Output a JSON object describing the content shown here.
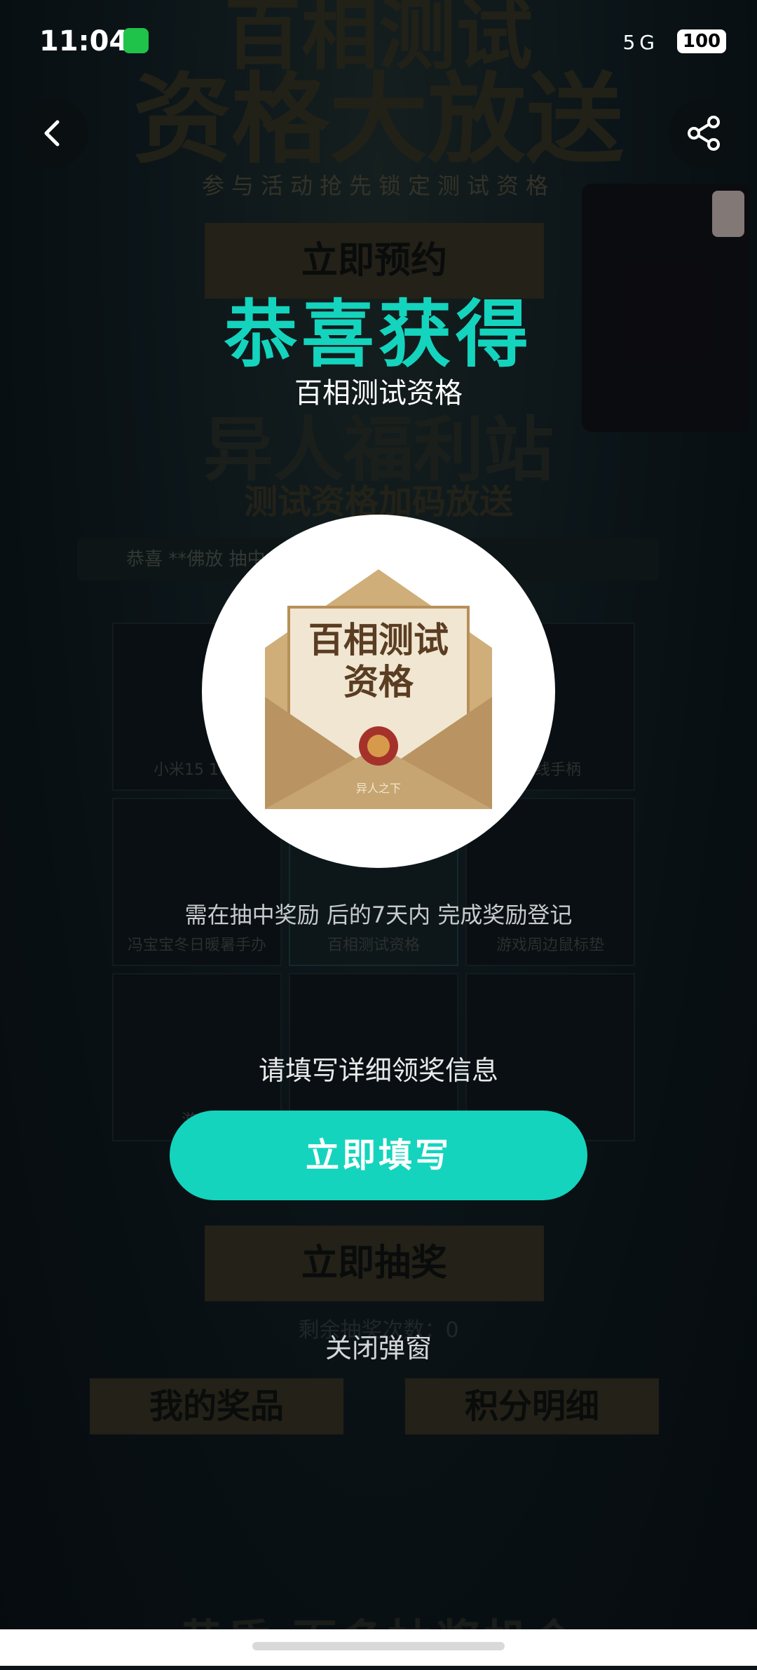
{
  "status_bar": {
    "time": "11:04",
    "signal": "5G",
    "battery": "100"
  },
  "nav": {
    "back_icon": "chevron-left-icon",
    "share_icon": "share-icon"
  },
  "background": {
    "title_line1": "百相测试",
    "title_line2": "资格大放送",
    "subtitle": "参与活动抢先锁定测试资格",
    "reserve_button": "立即预约",
    "welfare_title": "异人福利站",
    "welfare_subtitle": "测试资格加码放送",
    "ticker": "恭喜 **佛放 抽中",
    "grid": [
      {
        "label": "小米15 16G"
      },
      {
        "label": ""
      },
      {
        "label": "无线手柄"
      },
      {
        "label": "冯宝宝冬日暖暑手办"
      },
      {
        "label": "百相测试资格"
      },
      {
        "label": "游戏周边鼠标垫"
      },
      {
        "label": "游戏"
      },
      {
        "label": ""
      },
      {
        "label": ""
      }
    ],
    "draw_button": "立即抽奖",
    "remaining": "剩余抽奖次数：0",
    "my_prizes_button": "我的奖品",
    "points_button": "积分明细",
    "footer_title": "黄昏·百多抽奖机会"
  },
  "modal": {
    "title": "恭喜获得",
    "prize_name": "百相测试资格",
    "prize_card_text_line1": "百相测试",
    "prize_card_text_line2": "资格",
    "prize_card_footer": "异人之下",
    "notice": "需在抽中奖励 后的7天内 完成奖励登记",
    "fill_hint": "请填写详细领奖信息",
    "fill_button": "立即填写",
    "close_link": "关闭弹窗",
    "accent_color": "#14d4be"
  }
}
